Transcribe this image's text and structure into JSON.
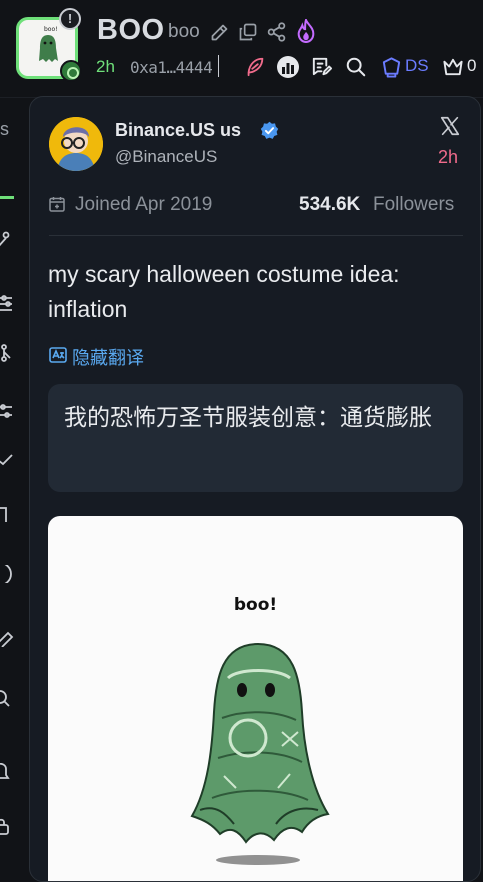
{
  "header": {
    "symbol": "BOO",
    "name": "boo",
    "age": "2h",
    "address": "0xa1…4444",
    "ds_label": "DS",
    "crown_count": "0",
    "warning_glyph": "!",
    "colors": {
      "accent_green": "#6fe07a",
      "ds_blue": "#6b7cff",
      "flame": "#c46bff",
      "feather": "#f06b8b"
    },
    "icons": [
      "edit-icon",
      "copy-icon",
      "share-icon",
      "flame-icon",
      "feather-icon",
      "chart-icon",
      "notes-icon",
      "search-icon",
      "shield-icon",
      "crown-icon"
    ]
  },
  "sidebar": {
    "tab_letter": "s",
    "icons": [
      "route-icon",
      "filter-icon",
      "nodes-icon",
      "sliders-icon",
      "check-icon",
      "bracket-icon",
      "circle-icon",
      "tag-icon",
      "search-icon",
      "bell-icon",
      "lock-icon"
    ]
  },
  "card": {
    "user": {
      "display_name": "Binance.US us",
      "handle": "@BinanceUS",
      "verified": true
    },
    "platform_icon": "x-logo-icon",
    "posted_age": "2h",
    "joined": "Joined Apr 2019",
    "followers_count": "534.6K",
    "followers_label": "Followers",
    "tweet_text": "my scary halloween costume idea: inflation",
    "hide_translation_label": "隐藏翻译",
    "translation_text": "我的恐怖万圣节服装创意：通货膨胀",
    "media": {
      "caption": "boo!",
      "image": "dollar-bill-ghost-illustration"
    }
  }
}
